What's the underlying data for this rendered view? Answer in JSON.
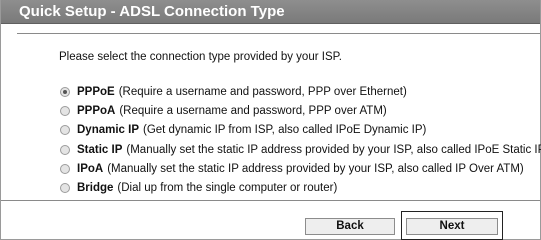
{
  "header": {
    "title": "Quick Setup - ADSL Connection Type"
  },
  "prompt": "Please select the connection type provided by your ISP.",
  "options": [
    {
      "name": "PPPoE",
      "description": "(Require a username and password, PPP over Ethernet)",
      "selected": true
    },
    {
      "name": "PPPoA",
      "description": "(Require a username and password, PPP over ATM)",
      "selected": false
    },
    {
      "name": "Dynamic IP",
      "description": "(Get dynamic IP from ISP, also called IPoE Dynamic IP)",
      "selected": false
    },
    {
      "name": "Static IP",
      "description": "(Manually set the static IP address provided by your ISP, also called IPoE Static IP)",
      "selected": false
    },
    {
      "name": "IPoA",
      "description": "(Manually set the static IP address provided by your ISP, also called IP Over ATM)",
      "selected": false
    },
    {
      "name": "Bridge",
      "description": "(Dial up from the single computer or router)",
      "selected": false
    }
  ],
  "buttons": {
    "back": "Back",
    "next": "Next"
  }
}
